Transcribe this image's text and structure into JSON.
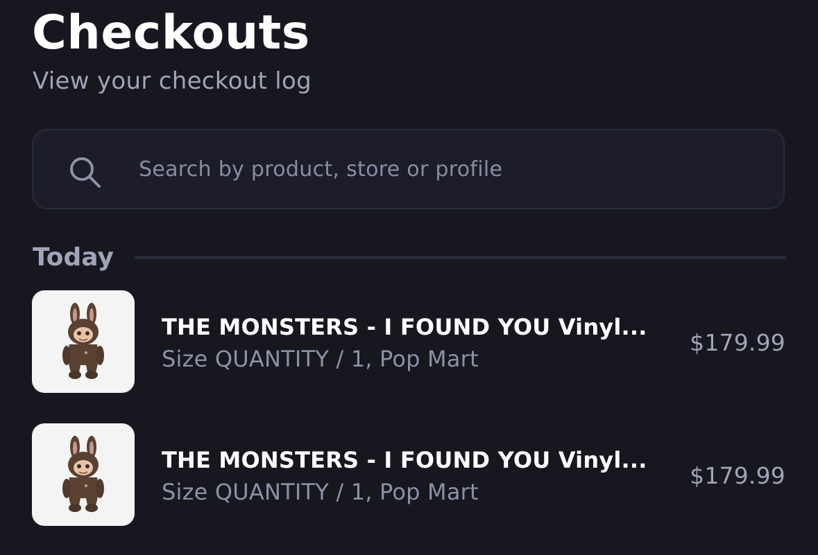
{
  "header": {
    "title": "Checkouts",
    "subtitle": "View your checkout log"
  },
  "search": {
    "value": "",
    "placeholder": "Search by product, store or profile",
    "icon": "search-icon"
  },
  "sections": [
    {
      "label": "Today",
      "items": [
        {
          "title": "THE MONSTERS - I FOUND YOU Vinyl...",
          "meta": "Size QUANTITY / 1, Pop Mart",
          "price": "$179.99",
          "thumbnail": "plush-toy-image"
        },
        {
          "title": "THE MONSTERS - I FOUND YOU Vinyl...",
          "meta": "Size QUANTITY / 1, Pop Mart",
          "price": "$179.99",
          "thumbnail": "plush-toy-image"
        }
      ]
    }
  ],
  "colors": {
    "background": "#17171f",
    "search_bg": "#1c1d29",
    "muted_text": "#a3a3b8",
    "thumb_bg": "#f4f4f4"
  }
}
